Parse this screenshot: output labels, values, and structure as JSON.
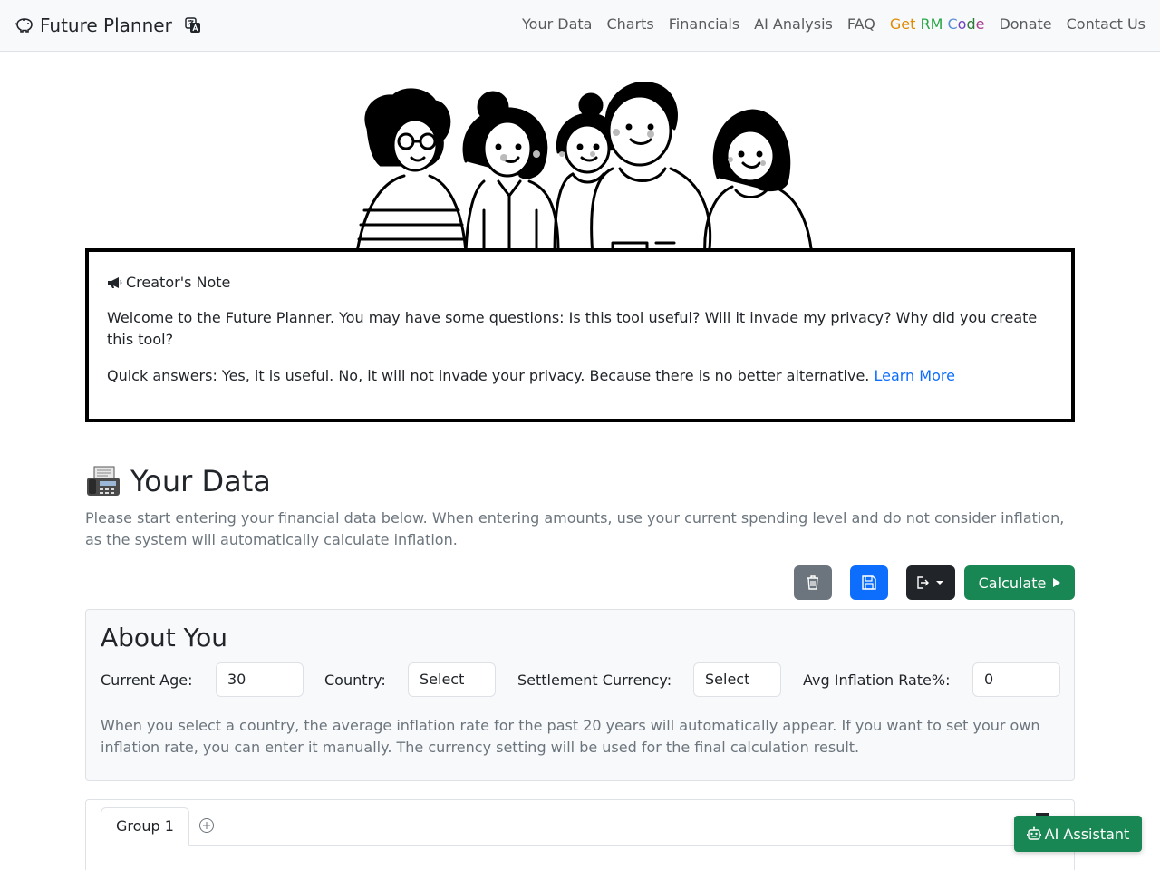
{
  "brand": {
    "title": "Future Planner",
    "logo_icon": "piggy-bank-icon",
    "language_icon": "translate-icon"
  },
  "nav": {
    "items": [
      "Your Data",
      "Charts",
      "Financials",
      "AI Analysis",
      "FAQ"
    ],
    "rm_code": [
      "Get",
      " RM",
      " C",
      "o",
      "d",
      "e"
    ],
    "donate": "Donate",
    "contact": "Contact Us"
  },
  "note": {
    "title": "Creator's Note",
    "p1": "Welcome to the Future Planner. You may have some questions: Is this tool useful? Will it invade my privacy? Why did you create this tool?",
    "p2": "Quick answers: Yes, it is useful. No, it will not invade your privacy. Because there is no better alternative.",
    "link": "Learn More"
  },
  "your_data": {
    "title": "Your Data",
    "description": "Please start entering your financial data below. When entering amounts, use your current spending level and do not consider inflation, as the system will automatically calculate inflation."
  },
  "toolbar": {
    "calculate": "Calculate"
  },
  "about": {
    "title": "About You",
    "age_label": "Current Age:",
    "age_value": "30",
    "country_label": "Country:",
    "country_value": "Select",
    "currency_label": "Settlement Currency:",
    "currency_value": "Select",
    "inflation_label": "Avg Inflation Rate%:",
    "inflation_value": "0",
    "help": "When you select a country, the average inflation rate for the past 20 years will automatically appear. If you want to set your own inflation rate, you can enter it manually. The currency setting will be used for the final calculation result."
  },
  "group": {
    "tab": "Group 1"
  },
  "assistant": {
    "label": "AI Assistant"
  },
  "colors": {
    "primary": "#0d6efd",
    "success": "#198754",
    "secondary": "#6c757d",
    "dark": "#212529"
  }
}
